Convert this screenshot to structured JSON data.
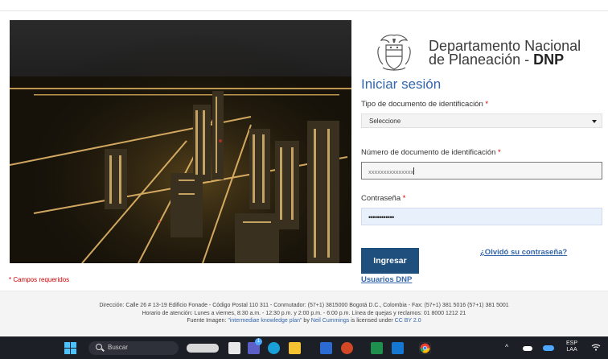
{
  "header": {
    "org_line1": "Departamento Nacional",
    "org_line2_prefix": "de Planeación - ",
    "org_line2_bold": "DNP"
  },
  "login": {
    "title": "Iniciar sesión",
    "doc_type_label": "Tipo de documento de identificación",
    "doc_type_value": "Seleccione",
    "doc_number_label": "Número de documento de identificación",
    "doc_number_value": "xxxxxxxxxxxxxxx",
    "password_label": "Contraseña",
    "password_value": "••••••••••••",
    "required_mark": "*",
    "submit_label": "Ingresar",
    "forgot_label": "¿Olvidó su contraseña?",
    "users_link": "Usuarios DNP",
    "required_note": "* Campos requeridos"
  },
  "footer": {
    "line1": "Dirección: Calle 26 # 13-19 Edificio Fonade - Código Postal 110 311 - Conmutador: (57+1) 3815000 Bogotá D.C., Colombia - Fax: (57+1) 381 5016 (57+1) 381 5001",
    "line2": "Horario de atención: Lunes a viernes, 8:30 a.m. - 12:30 p.m. y 2:00 p.m. - 6:00 p.m. Línea de quejas y reclamos: 01 8000 1212 21",
    "credit_prefix": "Fuente Imagen: ",
    "credit_work": "\"intermediae knowledge plan\"",
    "credit_by": " by ",
    "credit_author": "Neil Cummings",
    "credit_licensed": " is licensed under ",
    "credit_license": "CC BY 2.0"
  },
  "taskbar": {
    "search_placeholder": "Buscar",
    "teams_badge": "1",
    "lang_line1": "ESP",
    "lang_line2": "LAA",
    "apps": [
      "windows-start-icon",
      "widgets-icon",
      "task-view-icon",
      "teams-icon",
      "edge-icon",
      "file-explorer-icon",
      "word-icon",
      "powerpoint-icon",
      "excel-icon",
      "outlook-icon",
      "chrome-icon"
    ]
  },
  "colors": {
    "accent": "#3366aa",
    "button": "#1e4f7d",
    "required": "#d00000",
    "taskbar": "#1c1f26"
  }
}
